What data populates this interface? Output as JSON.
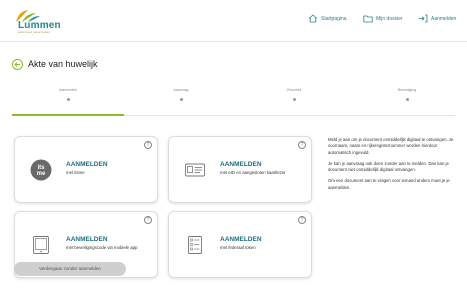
{
  "header": {
    "logo_text": "Lummen",
    "logo_tagline": "samen leven, samen werken",
    "nav": [
      {
        "label": "Startpagina",
        "icon": "home-icon"
      },
      {
        "label": "Mijn dossier",
        "icon": "folder-icon"
      },
      {
        "label": "Aanmelden",
        "icon": "login-icon"
      }
    ]
  },
  "page": {
    "title": "Akte van huwelijk"
  },
  "stepper": {
    "steps": [
      "Aanmelden",
      "Aanvraag",
      "Overzicht",
      "Bevestiging"
    ],
    "active_index": 0
  },
  "cards": [
    {
      "title": "AANMELDEN",
      "subtitle": "met itsme",
      "icon": "itsme-icon"
    },
    {
      "title": "AANMELDEN",
      "subtitle": "met eID en aangesloten kaartlezer",
      "icon": "id-card-icon"
    },
    {
      "title": "AANMELDEN",
      "subtitle": "met beveiligingscode via mobiele app",
      "icon": "tablet-icon"
    },
    {
      "title": "AANMELDEN",
      "subtitle": "met federaal token",
      "icon": "token-icon"
    }
  ],
  "card_help_symbol": "?",
  "info": {
    "paragraphs": [
      "Meld je aan om je document onmiddellijk digitaal te ontvangen. Je voornaam, naam en rijksregisternummer worden hierdoor automatisch ingevuld.",
      "Je kan je aanvraag ook doen zonder aan te melden. Dan kan je document niet onmiddellijk digitaal ontvangen.",
      "Om een document aan te vragen voor iemand anders moet je je aanmelden."
    ]
  },
  "footer": {
    "skip_label": "Verdergaan zonder aanmelden"
  },
  "colors": {
    "accent_green": "#8dbb2e",
    "brand_teal": "#1d6e83",
    "nav_teal": "#2d7f86"
  }
}
